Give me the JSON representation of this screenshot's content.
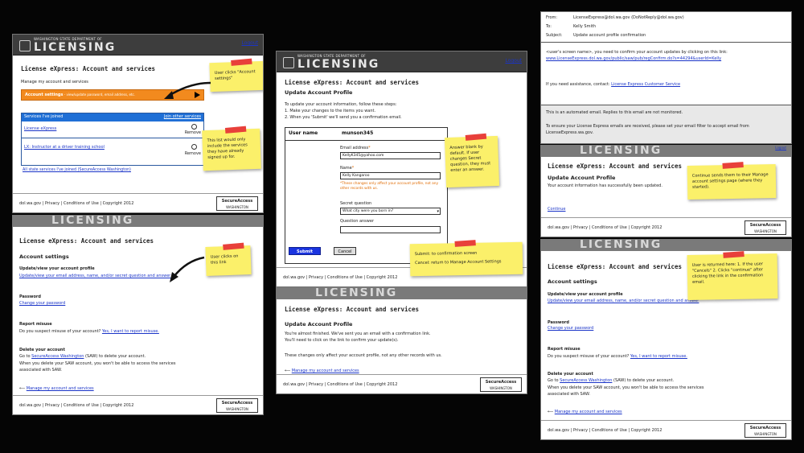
{
  "brand": {
    "small": "WASHINGTON STATE DEPARTMENT OF",
    "big": "LICENSING",
    "logout": "Logout"
  },
  "footer": {
    "text": "dol.wa.gov | Privacy | Conditions of Use | Copyright 2012",
    "sa_top": "SECURED BY",
    "sa_main": "SecureAccess",
    "sa_sub": "WASHINGTON"
  },
  "p1": {
    "title": "License eXpress: Account and services",
    "manage": "Manage my account and services",
    "orange_bold": "Account settings",
    "orange_rest": " - view/update password, email address, etc.",
    "joined_header": "Services I've joined",
    "join_link": "Join other services",
    "services": [
      {
        "label": "License eXpress",
        "remove": "Remove"
      },
      {
        "label": "LX: Instructor at a driver training school",
        "remove": "Remove"
      }
    ],
    "all_link": "All state services I've joined (SecureAccess Washington)",
    "note1": "User clicks \"Account settings\"",
    "note2": "This list would only include the services they have already signed up for."
  },
  "p2": {
    "title": "License eXpress: Account and services",
    "settings": "Account settings",
    "update_h": "Update/view your account profile",
    "update_link": "Update/view your email address, name, and/or secret question and answer",
    "pw_h": "Password",
    "pw_link": "Change your password",
    "misuse_h": "Report misuse",
    "misuse_t": "Do you suspect misuse of your account?",
    "misuse_link": "Yes, I want to report misuse.",
    "del_h": "Delete your account",
    "del_t1": "Go to",
    "del_link": "SecureAccess Washington",
    "del_t2": "(SAW) to delete your account.",
    "del_t3": "When you delete your SAW account, you won't be able to access the services associated with SAW.",
    "back": "Manage my account and services",
    "note": "User clicks on this link"
  },
  "p3": {
    "title": "License eXpress: Account and services",
    "sub": "Update Account Profile",
    "intro": "To update your account information, follow these steps:",
    "step1": "1. Make your changes to the items you want.",
    "step2": "2. When you 'Submit' we'll send you a confirmation email.",
    "user_label": "User name",
    "user_value": "munson345",
    "email_label": "Email address",
    "email_value": "KellyK345@yahoo.com",
    "name_label": "Name",
    "name_value": "Kelly Kangaroo",
    "warn": "*These changes only affect your account profile, not any other records with us.",
    "secret_label": "Secret question",
    "secret_value": "What city were you born in?",
    "answer_label": "Question answer",
    "submit": "Submit",
    "cancel": "Cancel",
    "note1": "Answer blank by default. If user changes Secret question, they must enter an answer.",
    "note2a": "Submit: to confirmation screen",
    "note2b": "Cancel: return to Manage Account Settings"
  },
  "p4": {
    "title": "License eXpress: Account and services",
    "sub": "Update Account Profile",
    "t1": "You're almost finished. We've sent you an email with a confirmation link.",
    "t2": "You'll need to click on the link to confirm your update(s).",
    "t3": "These changes only affect your account profile, not any other records with us.",
    "back": "Manage my account and services"
  },
  "email": {
    "from_l": "From:",
    "from_v": "LicenseExpress@dol.wa.gov (DoNotReply@dol.wa.gov)",
    "to_l": "To:",
    "to_v": "Kelly Smith",
    "subj_l": "Subject:",
    "subj_v": "Update account profile confirmation",
    "body1": "<user's screen name>, you need to confirm your account updates by clicking on this link:",
    "url": "www.LicenseExpress.dol.wa.gov/public/saw/pub/regConfirm.do?s=44294&userId=Kelly",
    "assist": "If you need assistance, contact:",
    "assist_link": "License Express Customer Service",
    "auto": "This is an automated email. Replies to this email are not monitored.",
    "filter": "To ensure your License Express emails are received, please set your email filter to accept email from LicenseExpress.wa.gov."
  },
  "p5": {
    "title": "License eXpress: Account and services",
    "sub": "Update Account Profile",
    "t1": "Your account information has successfully been updated.",
    "cont": "Continue",
    "note": "Continue sends them to their Manage account settings page (where they started)."
  },
  "p6": {
    "title": "License eXpress: Account and services",
    "settings": "Account settings",
    "note": "User is returned here: 1. If the user \"Cancels\" 2. Clicks \"continue\" after clicking the link in the confirmation email."
  }
}
